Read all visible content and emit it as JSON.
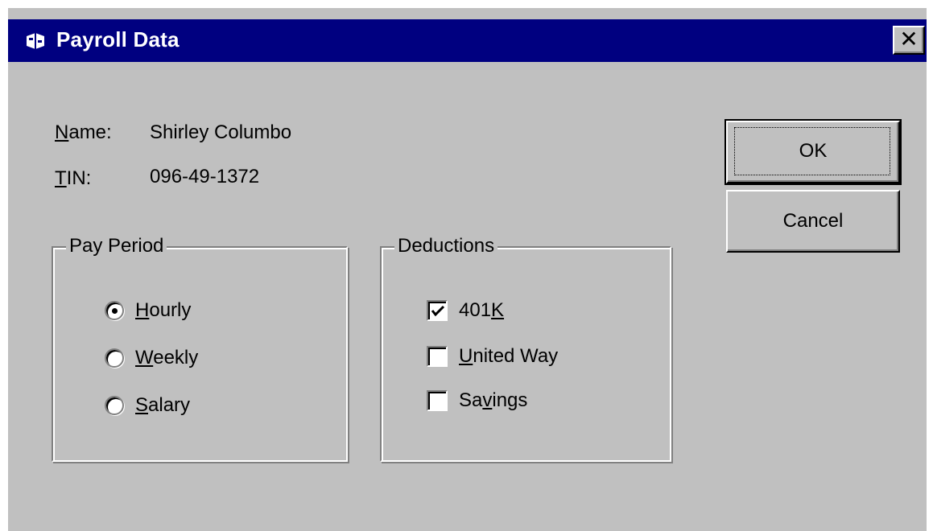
{
  "window": {
    "title": "Payroll Data",
    "close_glyph": "✕"
  },
  "icons": {
    "app": "payroll-app-icon",
    "close": "close-icon"
  },
  "fields": {
    "name_label": "Name:",
    "name_value": "Shirley Columbo",
    "tin_label": "TIN:",
    "tin_value": "096-49-1372"
  },
  "pay_period": {
    "title": "Pay Period",
    "options": [
      {
        "label": "Hourly",
        "selected": true
      },
      {
        "label": "Weekly",
        "selected": false
      },
      {
        "label": "Salary",
        "selected": false
      }
    ]
  },
  "deductions": {
    "title": "Deductions",
    "options": [
      {
        "label": "401K",
        "checked": true
      },
      {
        "label": "United Way",
        "checked": false
      },
      {
        "label": "Savings",
        "checked": false
      }
    ]
  },
  "buttons": {
    "ok": "OK",
    "cancel": "Cancel"
  },
  "colors": {
    "titlebar": "#000080",
    "face": "#c0c0c0"
  }
}
